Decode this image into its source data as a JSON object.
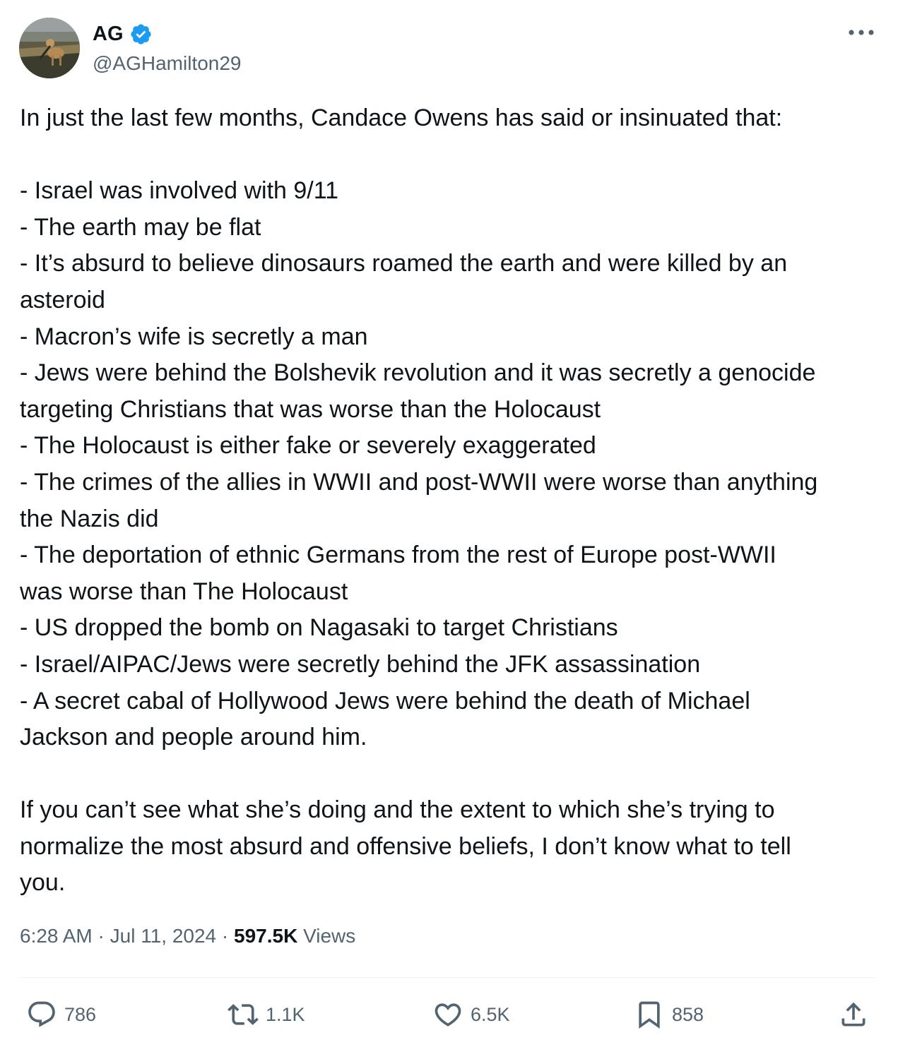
{
  "author": {
    "name": "AG",
    "handle": "@AGHamilton29",
    "verified": true,
    "verified_color": "#1d9bf0"
  },
  "tweet": {
    "lines": [
      "In just the last few months, Candace Owens has said or insinuated that:",
      "",
      "- Israel was involved with 9/11",
      "- The earth may be flat",
      "- It’s absurd to believe dinosaurs roamed the earth and were killed by an",
      "asteroid",
      "- Macron’s wife is secretly a man",
      "- Jews were behind the Bolshevik revolution and it was secretly a genocide",
      "targeting Christians that was worse than the Holocaust",
      "- The Holocaust is either fake or severely exaggerated",
      "- The crimes of the allies in WWII and post-WWII were worse than anything",
      "the Nazis did",
      "- The deportation of ethnic Germans from the rest of Europe post-WWII",
      "was worse than The Holocaust",
      "- US dropped the bomb on Nagasaki to target Christians",
      "- Israel/AIPAC/Jews were secretly behind the JFK assassination",
      "- A secret cabal of Hollywood Jews were behind the death of Michael",
      "Jackson and people around him.",
      "",
      "If you can’t see what she’s doing and the extent to which she’s trying to",
      "normalize the most absurd and offensive beliefs, I don’t know what to tell",
      "you."
    ]
  },
  "meta": {
    "time": "6:28 AM",
    "separator": " · ",
    "date": "Jul 11, 2024",
    "views_count": "597.5K",
    "views_label": " Views"
  },
  "actions": {
    "replies": "786",
    "reposts": "1.1K",
    "likes": "6.5K",
    "bookmarks": "858"
  },
  "icons": {
    "more": "more-horizontal-icon",
    "reply": "reply-icon",
    "repost": "repost-icon",
    "like": "heart-icon",
    "bookmark": "bookmark-icon",
    "share": "share-icon"
  },
  "colors": {
    "text": "#0f1419",
    "secondary": "#536471",
    "divider": "#eff3f4"
  }
}
